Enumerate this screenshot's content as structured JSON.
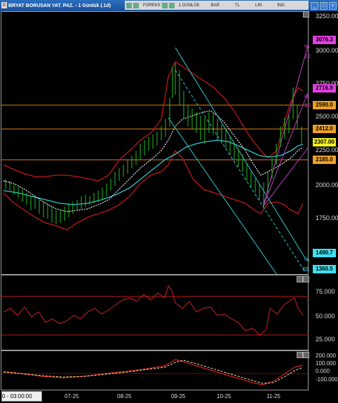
{
  "window": {
    "title": "BRYAT BORUSAN YAT. PAZ. - 1 Günlük (.1d)",
    "toolbar_items": [
      "FOREKS",
      "1 GÜNLÜK",
      "BAR",
      "TL",
      "LIN",
      "IND"
    ]
  },
  "price_axis": {
    "labels": [
      "3250.000",
      "3000.000",
      "2750.000",
      "2500.000",
      "2250.000",
      "2000.000",
      "1750.000"
    ],
    "tags": [
      {
        "text": "3076.3",
        "color": "#e040e0"
      },
      {
        "text": "2716.9",
        "color": "#e040e0"
      },
      {
        "text": "2590.0",
        "color": "#f0a020"
      },
      {
        "text": "2412.0",
        "color": "#f0a020"
      },
      {
        "text": "2307.00",
        "color": "#f0f020"
      },
      {
        "text": "2185.0",
        "color": "#f0a020"
      },
      {
        "text": "1490.7",
        "color": "#40e0f0"
      },
      {
        "text": "1360.5",
        "color": "#40e0f0"
      }
    ]
  },
  "fib_labels": [
    "%",
    "22",
    "%",
    "18",
    "%",
    "55"
  ],
  "rsi_axis": {
    "labels": [
      "75.000",
      "50.000",
      "25.000"
    ]
  },
  "macd_axis": {
    "labels": [
      "200.000",
      "100.000",
      "0.000",
      "-100.000"
    ]
  },
  "time_axis": {
    "current": "0 - 03:00:00",
    "labels": [
      "07-25",
      "08-25",
      "09-25",
      "10-25",
      "11-25"
    ]
  }
}
